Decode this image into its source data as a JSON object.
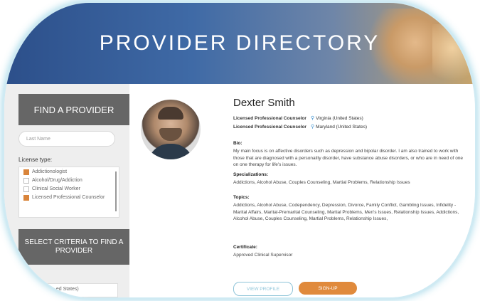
{
  "banner": {
    "title": "PROVIDER DIRECTORY"
  },
  "sidebar": {
    "heading": "FIND A PROVIDER",
    "last_name_placeholder": "Last Name",
    "license_label": "License type:",
    "license_types": [
      {
        "label": "Addictionologist",
        "checked": true
      },
      {
        "label": "Alcohol/Drug/Addiction",
        "checked": false
      },
      {
        "label": "Clinical Social Worker",
        "checked": false
      },
      {
        "label": "Licensed Professional Counselor",
        "checked": true
      }
    ],
    "criteria_heading": "SELECT CRITERIA TO FIND A PROVIDER",
    "states_partial": "...ed States)"
  },
  "provider": {
    "name": "Dexter Smith",
    "credentials": [
      {
        "title": "Licensed Professional Counselor",
        "location": "Virginia (United States)"
      },
      {
        "title": "Licensed Professional Counselor",
        "location": "Maryland (United States)"
      }
    ],
    "bio_label": "Bio:",
    "bio": "My main focus is on affective disorders such as depression and bipolar disorder. I am also trained to work with those that are diagnosed with a personality disorder, have substance abuse disorders, or who are in need of one on one therapy for life's issues.",
    "specializations_label": "Specializations:",
    "specializations": "Addictions, Alcohol Abuse, Couples Counseling, Martial Problems, Relationship Issues",
    "topics_label": "Topics:",
    "topics": "Addictions, Alcohol Abuse, Codependency, Depression, Divorce, Family Conflict, Gambling Issues, Infidelity - Marital Affairs, Marital-Premarital Counseling, Martial Problems, Men's Issues, Relationship Issues, Addictions, Alcohol Abuse, Couples Counseling, Martial Problems, Relationship Issues,",
    "certificate_label": "Certificate:",
    "certificate": "Approved Clinical Supervisor"
  },
  "buttons": {
    "view_profile": "VIEW PROFILE",
    "sign_up": "SIGN-UP"
  },
  "colors": {
    "accent_orange": "#e08a3c",
    "sidebar_header": "#666666",
    "banner_blue": "#3f6aa6",
    "outline_blue": "#8ec4d8"
  }
}
